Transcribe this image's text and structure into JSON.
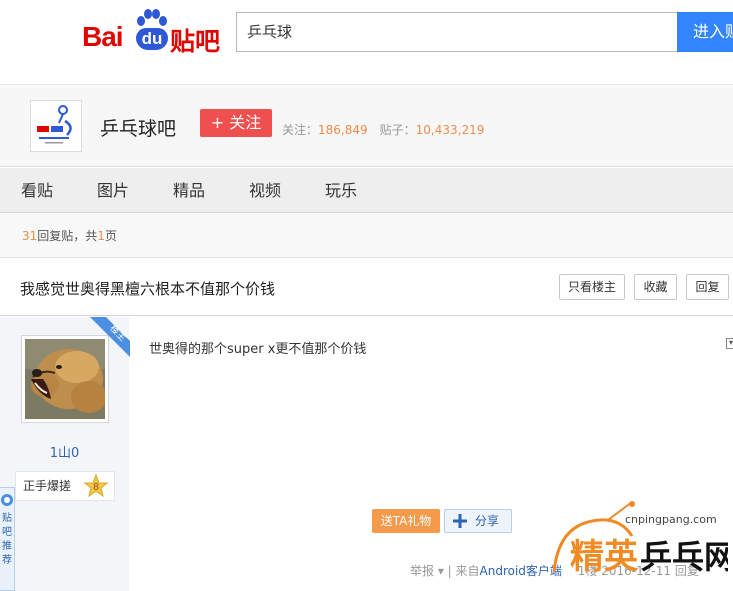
{
  "header": {
    "logo": {
      "bai": "Bai",
      "du": "du",
      "tieba": "贴吧"
    },
    "search_value": "乒乓球",
    "search_button": "进入贴吧"
  },
  "forum": {
    "name": "乒乓球吧",
    "follow_label": "+ 关注",
    "followers_label": "关注：",
    "followers_count": "186,849",
    "posts_label": "贴子：",
    "posts_count": "10,433,219"
  },
  "nav": {
    "items": [
      "看贴",
      "图片",
      "精品",
      "视频",
      "玩乐"
    ]
  },
  "reply_info": {
    "count": "31",
    "text1": "回复贴，共",
    "pages": "1",
    "text2": "页"
  },
  "thread": {
    "title": "我感觉世奥得黑檀六根本不值那个价钱",
    "btn_only_op": "只看楼主",
    "btn_favorite": "收藏",
    "btn_reply": "回复"
  },
  "post": {
    "op_tag": "楼主",
    "author": "1山0",
    "badge_label": "正手爆搓",
    "badge_level": "8",
    "side_tab_text": "贴吧推荐",
    "content": "世奥得的那个super x更不值那个价钱",
    "gift_label": "送TA礼物",
    "share_label": "分享",
    "tail_report": "举报",
    "tail_from": "| 来自",
    "tail_source": "Android客户端",
    "tail_floor": "1楼",
    "tail_date": "2016-12-11",
    "tail_reply": "回复"
  },
  "watermark": {
    "domain": "cnpingpang.com",
    "text_a": "精英",
    "text_b": "乒乓网"
  },
  "colors": {
    "brand_red": "#e10602",
    "brand_blue": "#2e58d6",
    "search_blue": "#3385ff",
    "follow_red": "#ee5050",
    "stat_orange": "#f08c4b",
    "link_blue": "#2d64b3"
  }
}
